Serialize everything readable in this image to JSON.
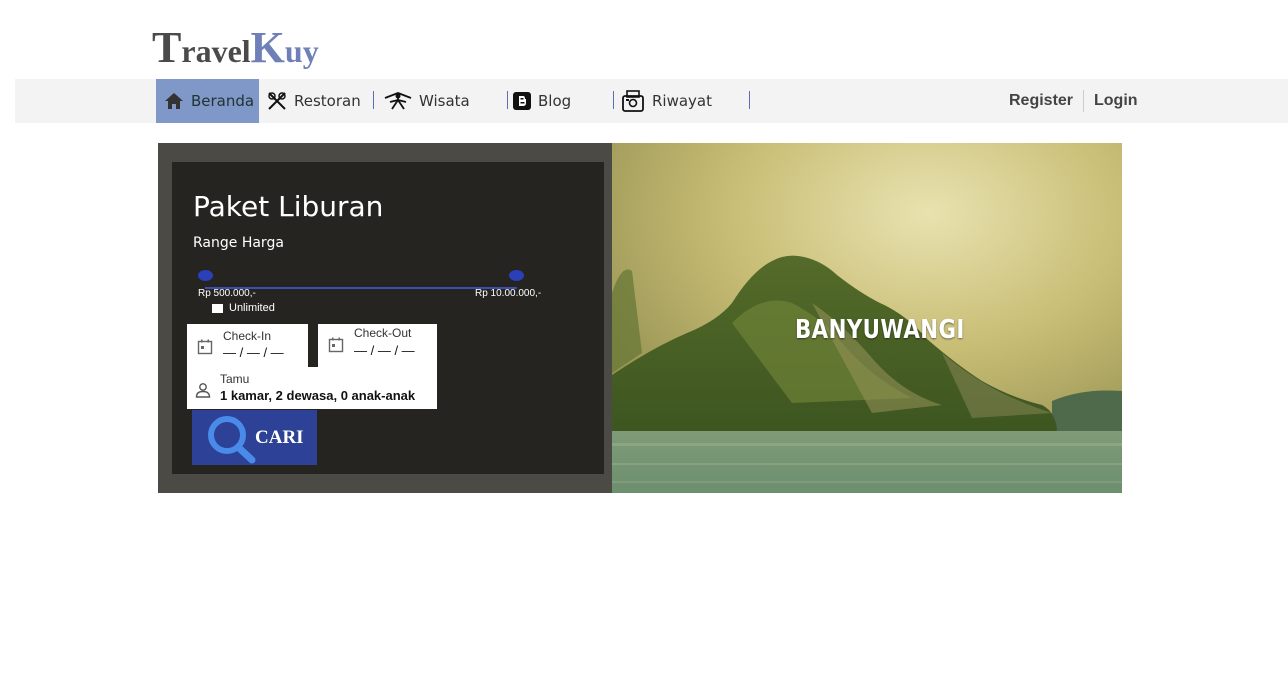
{
  "brand": {
    "part1_big": "T",
    "part1_small": "ravel",
    "part2_big": "K",
    "part2_small": "uy"
  },
  "nav": {
    "items": [
      {
        "label": "Beranda",
        "icon": "home-icon",
        "active": true
      },
      {
        "label": "Restoran",
        "icon": "restaurant-icon"
      },
      {
        "label": "Wisata",
        "icon": "travel-icon"
      },
      {
        "label": "Blog",
        "icon": "blog-icon"
      },
      {
        "label": "Riwayat",
        "icon": "history-icon"
      }
    ],
    "register": "Register",
    "login": "Login"
  },
  "search": {
    "title": "Paket Liburan",
    "range_label": "Range Harga",
    "price_min": "Rp 500.000,-",
    "price_max": "Rp 10.00.000,-",
    "unlimited_label": "Unlimited",
    "checkin_label": "Check-In",
    "checkin_value": "— / — / —",
    "checkout_label": "Check-Out",
    "checkout_value": "— / — / —",
    "guest_label": "Tamu",
    "guest_value": "1 kamar, 2 dewasa, 0 anak-anak",
    "search_button": "CARI"
  },
  "hero": {
    "caption": "BANYUWANGI"
  },
  "colors": {
    "nav_active": "#7f98c7",
    "accent_blue": "#2d4196",
    "panel_bg": "#262421"
  }
}
